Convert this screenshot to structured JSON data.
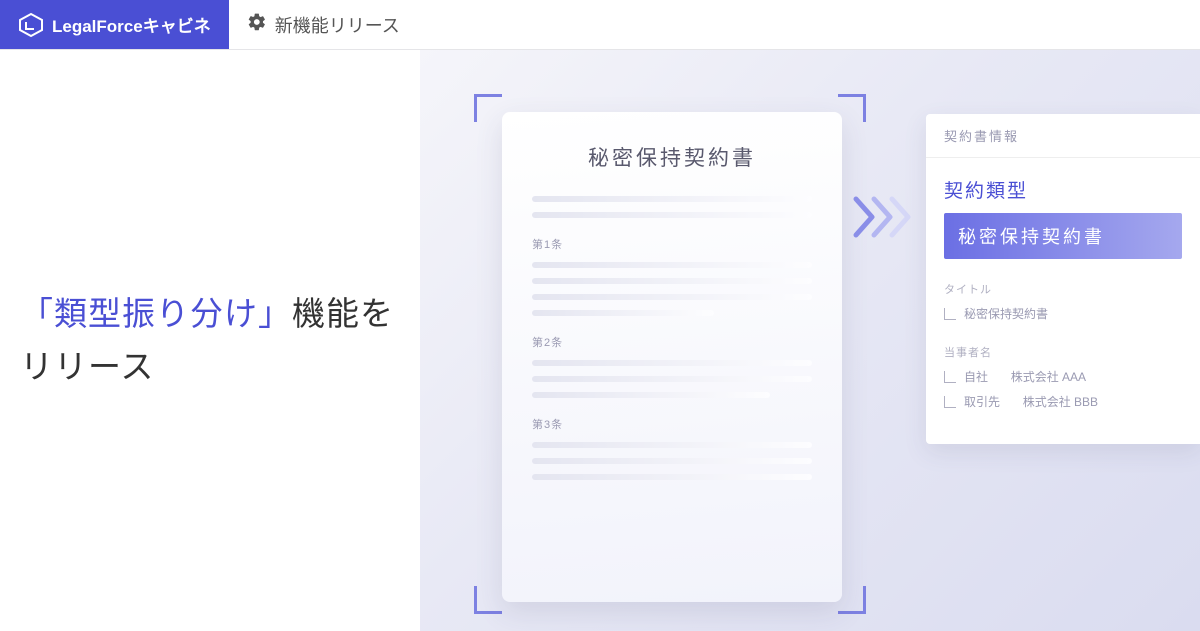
{
  "header": {
    "logo_text": "LegalForceキャビネ",
    "nav_label": "新機能リリース"
  },
  "headline": {
    "bracket_open": "「",
    "emph": "類型振り分け",
    "bracket_close": "」",
    "tail1": "機能を",
    "line2": "リリース"
  },
  "document": {
    "title": "秘密保持契約書",
    "sections": [
      "第1条",
      "第2条",
      "第3条"
    ]
  },
  "info": {
    "header": "契約書情報",
    "type_label": "契約類型",
    "type_value": "秘密保持契約書",
    "title_label": "タイトル",
    "title_value": "秘密保持契約書",
    "party_label": "当事者名",
    "parties": [
      {
        "role": "自社",
        "name": "株式会社 AAA"
      },
      {
        "role": "取引先",
        "name": "株式会社 BBB"
      }
    ]
  }
}
